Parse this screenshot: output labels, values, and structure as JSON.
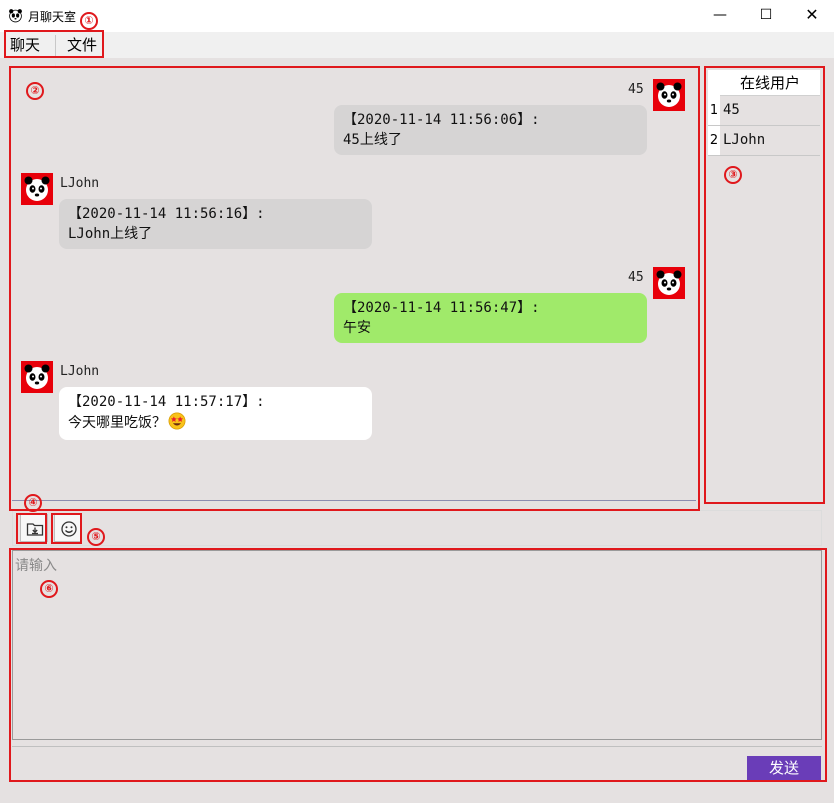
{
  "window": {
    "title": "月聊天室",
    "minimize_label": "—",
    "maximize_label": "☐",
    "close_label": "✕"
  },
  "menu": {
    "items": [
      {
        "label": "聊天"
      },
      {
        "label": "文件"
      }
    ]
  },
  "chat": {
    "messages": [
      {
        "sender": "45",
        "side": "right",
        "timestamp": "【2020-11-14 11:56:06】:",
        "text": "45上线了",
        "bubble_color": "gray"
      },
      {
        "sender": "LJohn",
        "side": "left",
        "timestamp": "【2020-11-14 11:56:16】:",
        "text": "LJohn上线了",
        "bubble_color": "gray"
      },
      {
        "sender": "45",
        "side": "right",
        "timestamp": "【2020-11-14 11:56:47】:",
        "text": "午安",
        "bubble_color": "green"
      },
      {
        "sender": "LJohn",
        "side": "left",
        "timestamp": "【2020-11-14 11:57:17】:",
        "text": "今天哪里吃饭？",
        "emoji": "star-struck-emoji",
        "bubble_color": "white"
      }
    ]
  },
  "users": {
    "header": "在线用户",
    "rows": [
      {
        "index": "1",
        "name": "45"
      },
      {
        "index": "2",
        "name": "LJohn"
      }
    ]
  },
  "toolbar": {
    "file_icon": "folder-download-icon",
    "emoji_icon": "smiley-icon"
  },
  "input": {
    "placeholder": "请输入",
    "value": ""
  },
  "send": {
    "label": "发送"
  },
  "annotations": [
    "①",
    "②",
    "③",
    "④",
    "⑤",
    "⑥"
  ],
  "colors": {
    "annotation_red": "#e0181c",
    "send_button": "#6a3db8",
    "bubble_green": "#a0ea6a",
    "bubble_gray": "#d6d4d4",
    "background": "#e5e1e1"
  }
}
